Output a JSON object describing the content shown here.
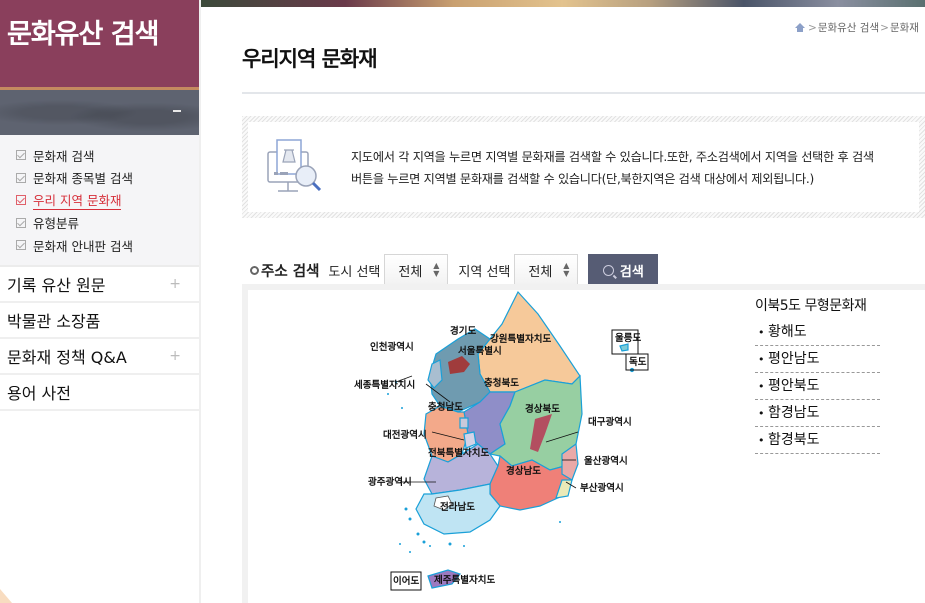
{
  "sidebar": {
    "title": "문화유산 검색",
    "submenu": [
      {
        "label": "문화재 검색",
        "active": false
      },
      {
        "label": "문화재 종목별 검색",
        "active": false
      },
      {
        "label": "우리 지역 문화재",
        "active": true
      },
      {
        "label": "유형분류",
        "active": false
      },
      {
        "label": "문화재 안내판 검색",
        "active": false
      }
    ],
    "menu": [
      {
        "label": "기록 유산 원문",
        "expandable": true
      },
      {
        "label": "박물관 소장품",
        "expandable": false
      },
      {
        "label": "문화재 정책 Q&A",
        "expandable": true
      },
      {
        "label": "용어 사전",
        "expandable": false
      }
    ],
    "plus_symbol": "+"
  },
  "breadcrumb": {
    "items": [
      "문화유산 검색",
      "문화재"
    ],
    "separator": ">"
  },
  "page": {
    "title": "우리지역 문화재"
  },
  "info": {
    "line1": "지도에서 각 지역을 누르면 지역별 문화재를 검색할 수 있습니다.또한, 주소검색에서 지역을 선택한 후 검색",
    "line2": "버튼을 누르면 지역별 문화재를 검색할 수 있습니다(단,북한지역은 검색 대상에서 제외됩니다.)"
  },
  "search": {
    "title": "주소 검색",
    "city_label": "도시 선택",
    "city_value": "전체",
    "region_label": "지역 선택",
    "region_value": "전체",
    "button_label": "검색"
  },
  "map": {
    "regions": [
      {
        "name": "경기도",
        "color": "#6f9bb0"
      },
      {
        "name": "서울특별시",
        "color": "#a03c3c"
      },
      {
        "name": "인천광역시",
        "color": "#a9bed0"
      },
      {
        "name": "강원특별자치도",
        "color": "#f6c99a"
      },
      {
        "name": "충청북도",
        "color": "#8f8ec8"
      },
      {
        "name": "세종특별자치시",
        "color": "#c9c9da"
      },
      {
        "name": "충청남도",
        "color": "#f3a98a"
      },
      {
        "name": "대전광역시",
        "color": "#d5d3e6"
      },
      {
        "name": "경상북도",
        "color": "#97cfa2"
      },
      {
        "name": "대구광역시",
        "color": "#b34e60"
      },
      {
        "name": "전북특별자치도",
        "color": "#b7b3da"
      },
      {
        "name": "경상남도",
        "color": "#ef8078"
      },
      {
        "name": "울산광역시",
        "color": "#e9a9a8"
      },
      {
        "name": "부산광역시",
        "color": "#eaeab8"
      },
      {
        "name": "광주광역시",
        "color": "#ffffff"
      },
      {
        "name": "전라남도",
        "color": "#bfe4f3"
      },
      {
        "name": "제주특별자치도",
        "color": "#9c7ac0"
      }
    ],
    "islands": [
      "울릉도",
      "독도",
      "이어도"
    ],
    "coast_color": "#1aa0d8"
  },
  "north_korea": {
    "heading": "이북5도 무형문화재",
    "items": [
      "황해도",
      "평안남도",
      "평안북도",
      "함경남도",
      "함경북도"
    ]
  }
}
